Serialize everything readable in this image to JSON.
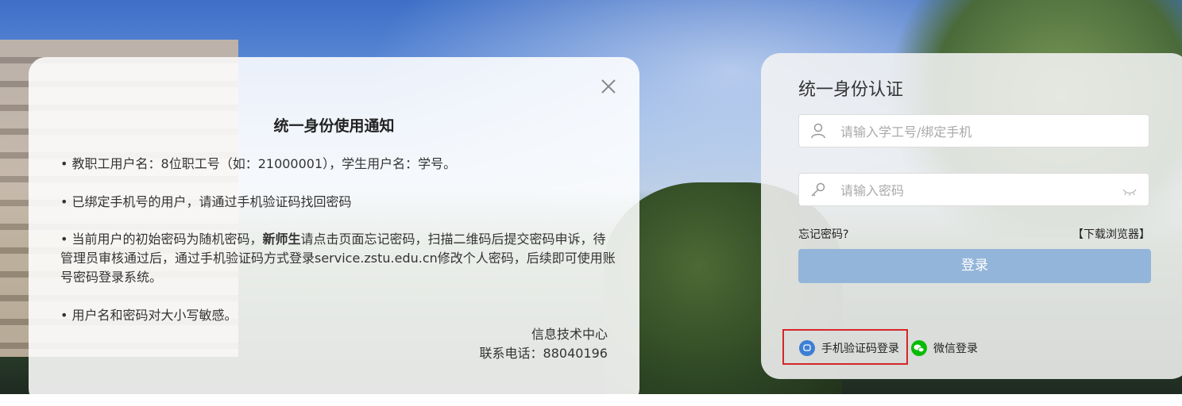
{
  "notice": {
    "title": "统一身份使用通知",
    "p1": "• 教职工用户名：8位职工号（如：21000001），学生用户名：学号。",
    "p2": "• 已绑定手机号的用户，请通过手机验证码找回密码",
    "p3_pre": "• 当前用户的初始密码为随机密码，",
    "p3_bold": "新师生",
    "p3_post": "请点击页面忘记密码，扫描二维码后提交密码申诉，待管理员审核通过后，通过手机验证码方式登录service.zstu.edu.cn修改个人密码，后续即可使用账号密码登录系统。",
    "p4": "• 用户名和密码对大小写敏感。",
    "sig_org": "信息技术中心",
    "sig_phone": "联系电话：88040196"
  },
  "login": {
    "heading": "统一身份认证",
    "user_placeholder": "请输入学工号/绑定手机",
    "pwd_placeholder": "请输入密码",
    "forgot": "忘记密码?",
    "download": "【下载浏览器】",
    "submit": "登录",
    "sms_login": "手机验证码登录",
    "wechat_login": "微信登录"
  },
  "colors": {
    "button": "#93b5d9",
    "sms_icon": "#3d7fd4",
    "wechat_icon": "#09bb07",
    "highlight_box": "#d6262a"
  },
  "icons": [
    "close-icon",
    "user-icon",
    "key-icon",
    "eye-closed-icon",
    "sms-icon",
    "wechat-icon"
  ]
}
